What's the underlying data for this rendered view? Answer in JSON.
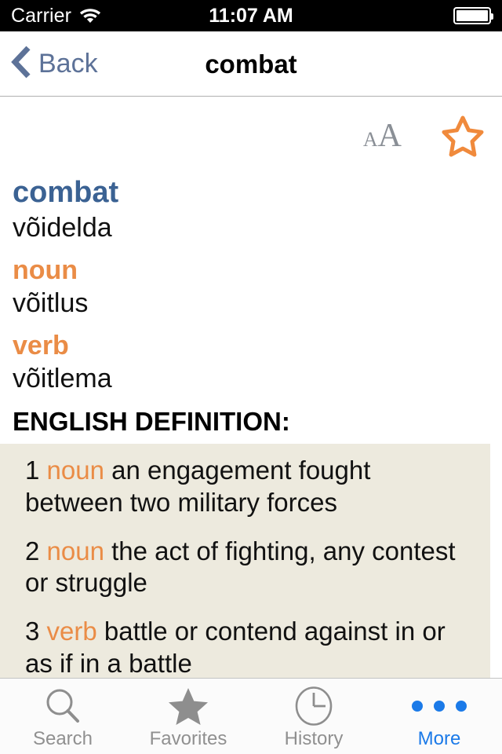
{
  "status_bar": {
    "carrier": "Carrier",
    "wifi_icon": "wifi-icon",
    "time": "11:07 AM",
    "battery_icon": "battery-full-icon"
  },
  "nav_bar": {
    "back_label": "Back",
    "back_icon": "chevron-left-icon",
    "title": "combat"
  },
  "toolbar": {
    "text_size_small": "A",
    "text_size_large": "A",
    "text_size_icon": "text-size-icon",
    "favorite_icon": "star-outline-icon"
  },
  "entry": {
    "headword": "combat",
    "headword_translation": "võidelda",
    "senses": [
      {
        "pos": "noun",
        "translation": "võitlus"
      },
      {
        "pos": "verb",
        "translation": "võitlema"
      }
    ],
    "definition_heading": "ENGLISH DEFINITION:",
    "definitions": [
      {
        "num": "1",
        "pos": "noun",
        "text": "an engagement fought between two military forces"
      },
      {
        "num": "2",
        "pos": "noun",
        "text": "the act of fighting, any contest or struggle"
      },
      {
        "num": "3",
        "pos": "verb",
        "text": "battle or contend against in or as if in a battle"
      }
    ]
  },
  "tab_bar": {
    "items": [
      {
        "label": "Search",
        "icon": "magnifier-icon",
        "active": false
      },
      {
        "label": "Favorites",
        "icon": "star-filled-icon",
        "active": false
      },
      {
        "label": "History",
        "icon": "clock-icon",
        "active": false
      },
      {
        "label": "More",
        "icon": "ellipsis-icon",
        "active": true
      }
    ]
  },
  "colors": {
    "accent_blue": "#1b7ae8",
    "headword_blue": "#3b6293",
    "nav_blue": "#5d7298",
    "orange": "#ea8c46",
    "definition_bg": "#edeade",
    "tab_gray": "#909090"
  }
}
